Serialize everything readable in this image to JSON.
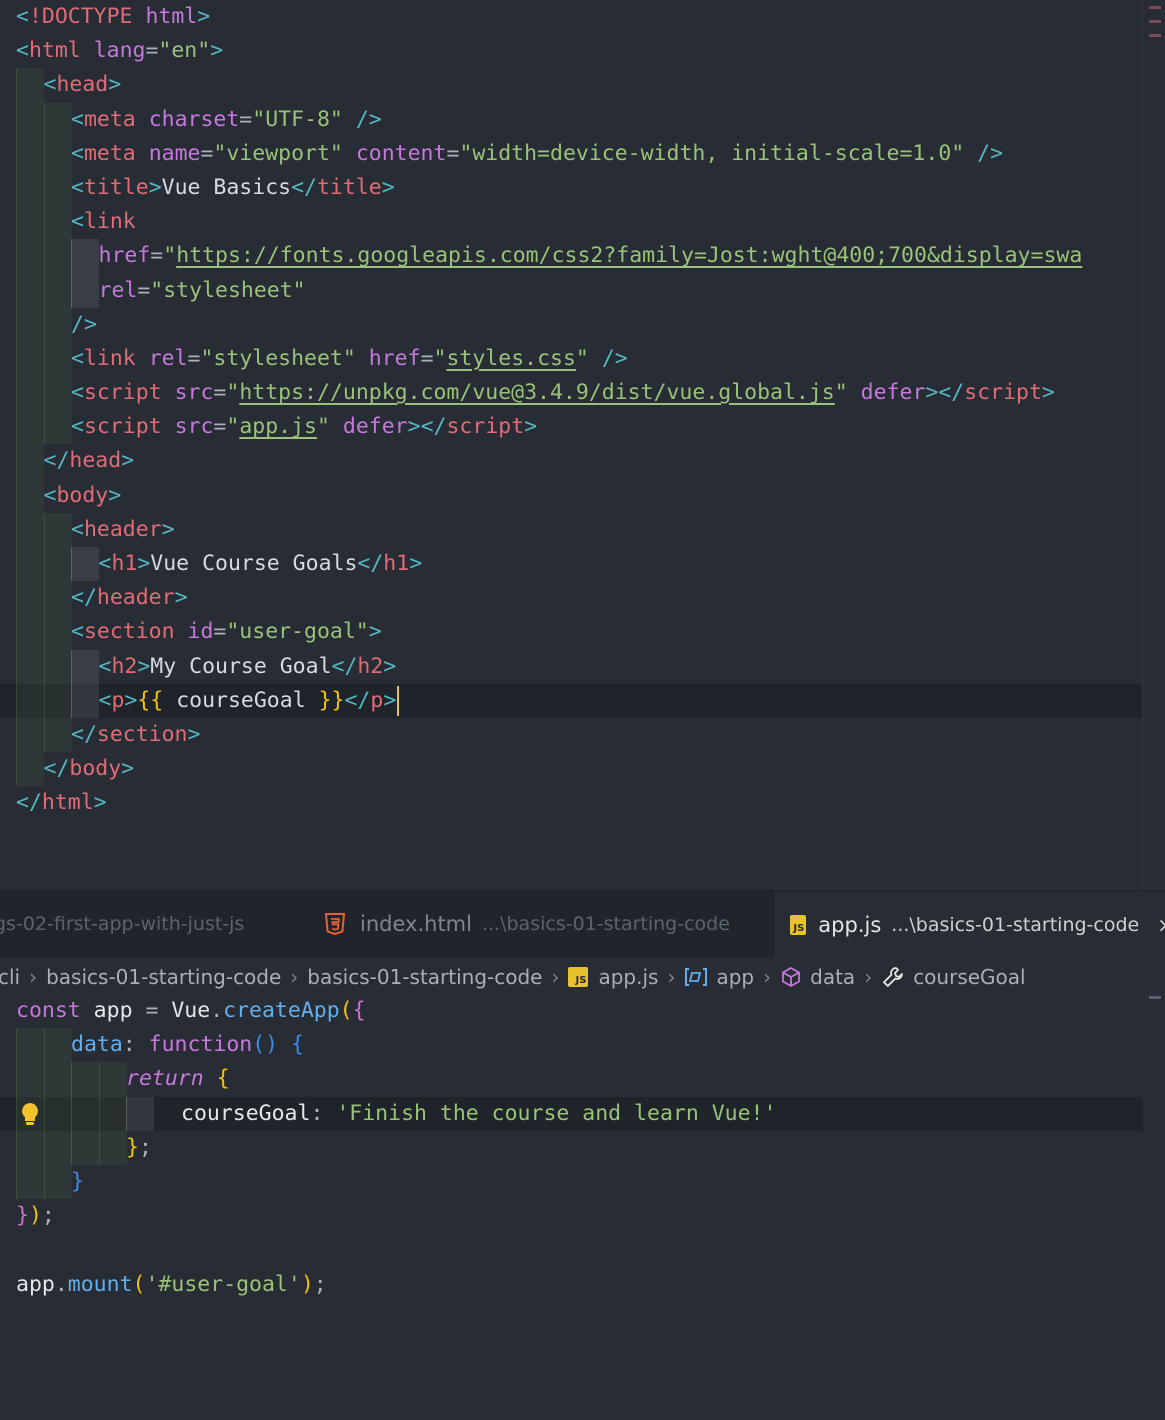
{
  "html_editor": {
    "lines": [
      [
        [
          "br",
          "<"
        ],
        [
          "tag",
          "!DOCTYPE"
        ],
        [
          "text",
          " "
        ],
        [
          "attr",
          "html"
        ],
        [
          "br",
          ">"
        ]
      ],
      [
        [
          "br",
          "<"
        ],
        [
          "tag",
          "html"
        ],
        [
          "text",
          " "
        ],
        [
          "attr",
          "lang"
        ],
        [
          "eq",
          "="
        ],
        [
          "str",
          "\"en\""
        ],
        [
          "br",
          ">"
        ]
      ],
      [
        [
          "br",
          "<"
        ],
        [
          "tag",
          "head"
        ],
        [
          "br",
          ">"
        ]
      ],
      [
        [
          "br",
          "<"
        ],
        [
          "tag",
          "meta"
        ],
        [
          "text",
          " "
        ],
        [
          "attr",
          "charset"
        ],
        [
          "eq",
          "="
        ],
        [
          "str",
          "\"UTF-8\""
        ],
        [
          "text",
          " "
        ],
        [
          "br",
          "/>"
        ]
      ],
      [
        [
          "br",
          "<"
        ],
        [
          "tag",
          "meta"
        ],
        [
          "text",
          " "
        ],
        [
          "attr",
          "name"
        ],
        [
          "eq",
          "="
        ],
        [
          "str",
          "\"viewport\""
        ],
        [
          "text",
          " "
        ],
        [
          "attr",
          "content"
        ],
        [
          "eq",
          "="
        ],
        [
          "str",
          "\"width=device-width, initial-scale=1.0\""
        ],
        [
          "text",
          " "
        ],
        [
          "br",
          "/>"
        ]
      ],
      [
        [
          "br",
          "<"
        ],
        [
          "tag",
          "title"
        ],
        [
          "br",
          ">"
        ],
        [
          "text",
          "Vue Basics"
        ],
        [
          "br",
          "</"
        ],
        [
          "tag",
          "title"
        ],
        [
          "br",
          ">"
        ]
      ],
      [
        [
          "br",
          "<"
        ],
        [
          "tag",
          "link"
        ]
      ],
      [
        [
          "attr",
          "href"
        ],
        [
          "eq",
          "="
        ],
        [
          "str",
          "\""
        ],
        [
          "url",
          "https://fonts.googleapis.com/css2?family=Jost:wght@400;700&display=swa"
        ]
      ],
      [
        [
          "attr",
          "rel"
        ],
        [
          "eq",
          "="
        ],
        [
          "str",
          "\"stylesheet\""
        ]
      ],
      [
        [
          "br",
          "/>"
        ]
      ],
      [
        [
          "br",
          "<"
        ],
        [
          "tag",
          "link"
        ],
        [
          "text",
          " "
        ],
        [
          "attr",
          "rel"
        ],
        [
          "eq",
          "="
        ],
        [
          "str",
          "\"stylesheet\""
        ],
        [
          "text",
          " "
        ],
        [
          "attr",
          "href"
        ],
        [
          "eq",
          "="
        ],
        [
          "str",
          "\""
        ],
        [
          "url",
          "styles.css"
        ],
        [
          "str",
          "\""
        ],
        [
          "text",
          " "
        ],
        [
          "br",
          "/>"
        ]
      ],
      [
        [
          "br",
          "<"
        ],
        [
          "tag",
          "script"
        ],
        [
          "text",
          " "
        ],
        [
          "attr",
          "src"
        ],
        [
          "eq",
          "="
        ],
        [
          "str",
          "\""
        ],
        [
          "url",
          "https://unpkg.com/vue@3.4.9/dist/vue.global.js"
        ],
        [
          "str",
          "\""
        ],
        [
          "text",
          " "
        ],
        [
          "attr",
          "defer"
        ],
        [
          "br",
          "></"
        ],
        [
          "tag",
          "script"
        ],
        [
          "br",
          ">"
        ]
      ],
      [
        [
          "br",
          "<"
        ],
        [
          "tag",
          "script"
        ],
        [
          "text",
          " "
        ],
        [
          "attr",
          "src"
        ],
        [
          "eq",
          "="
        ],
        [
          "str",
          "\""
        ],
        [
          "url",
          "app.js"
        ],
        [
          "str",
          "\""
        ],
        [
          "text",
          " "
        ],
        [
          "attr",
          "defer"
        ],
        [
          "br",
          "></"
        ],
        [
          "tag",
          "script"
        ],
        [
          "br",
          ">"
        ]
      ],
      [
        [
          "br",
          "</"
        ],
        [
          "tag",
          "head"
        ],
        [
          "br",
          ">"
        ]
      ],
      [
        [
          "br",
          "<"
        ],
        [
          "tag",
          "body"
        ],
        [
          "br",
          ">"
        ]
      ],
      [
        [
          "br",
          "<"
        ],
        [
          "tag",
          "header"
        ],
        [
          "br",
          ">"
        ]
      ],
      [
        [
          "br",
          "<"
        ],
        [
          "tag",
          "h1"
        ],
        [
          "br",
          ">"
        ],
        [
          "text",
          "Vue Course Goals"
        ],
        [
          "br",
          "</"
        ],
        [
          "tag",
          "h1"
        ],
        [
          "br",
          ">"
        ]
      ],
      [
        [
          "br",
          "</"
        ],
        [
          "tag",
          "header"
        ],
        [
          "br",
          ">"
        ]
      ],
      [
        [
          "br",
          "<"
        ],
        [
          "tag",
          "section"
        ],
        [
          "text",
          " "
        ],
        [
          "attr",
          "id"
        ],
        [
          "eq",
          "="
        ],
        [
          "str",
          "\"user-goal\""
        ],
        [
          "br",
          ">"
        ]
      ],
      [
        [
          "br",
          "<"
        ],
        [
          "tag",
          "h2"
        ],
        [
          "br",
          ">"
        ],
        [
          "text",
          "My Course Goal"
        ],
        [
          "br",
          "</"
        ],
        [
          "tag",
          "h2"
        ],
        [
          "br",
          ">"
        ]
      ],
      [
        [
          "br",
          "<"
        ],
        [
          "tag",
          "p"
        ],
        [
          "br",
          ">"
        ],
        [
          "b1",
          "{{"
        ],
        [
          "text",
          " courseGoal "
        ],
        [
          "b1",
          "}}"
        ],
        [
          "br",
          "</"
        ],
        [
          "tag",
          "p"
        ],
        [
          "br",
          ">"
        ]
      ],
      [
        [
          "br",
          "</"
        ],
        [
          "tag",
          "section"
        ],
        [
          "br",
          ">"
        ]
      ],
      [
        [
          "br",
          "</"
        ],
        [
          "tag",
          "body"
        ],
        [
          "br",
          ">"
        ]
      ],
      [
        [
          "br",
          "</"
        ],
        [
          "tag",
          "html"
        ],
        [
          "br",
          ">"
        ]
      ]
    ]
  },
  "tabs": {
    "first": "gs-02-first-app-with-just-js",
    "index_name": "index.html",
    "index_path": "...\\basics-01-starting-code",
    "app_name": "app.js",
    "app_path": "...\\basics-01-starting-code",
    "close": "×"
  },
  "breadcrumb": {
    "cli": "cli",
    "folder1": "basics-01-starting-code",
    "folder2": "basics-01-starting-code",
    "file": "app.js",
    "sym1": "app",
    "sym2": "data",
    "sym3": "courseGoal",
    "sep": "›"
  },
  "icons": {
    "html_icon": "html5-icon",
    "js_icon": "js-file-icon",
    "js_badge": "JS",
    "variable_icon": "variable-icon",
    "cube_icon": "cube-icon",
    "wrench_icon": "wrench-icon",
    "lightbulb_icon": "lightbulb-icon"
  },
  "js_editor": {
    "lines": [
      [
        [
          "kw",
          "const"
        ],
        [
          "var",
          " app "
        ],
        [
          "punc",
          "= "
        ],
        [
          "var",
          "Vue"
        ],
        [
          "punc",
          "."
        ],
        [
          "fn",
          "createApp"
        ],
        [
          "b1",
          "("
        ],
        [
          "b2",
          "{"
        ]
      ],
      [
        [
          "prop",
          "data"
        ],
        [
          "punc",
          ": "
        ],
        [
          "kw",
          "function"
        ],
        [
          "b3",
          "()"
        ],
        [
          "punc",
          " "
        ],
        [
          "b3",
          "{"
        ]
      ],
      [
        [
          "ret",
          "return"
        ],
        [
          "punc",
          " "
        ],
        [
          "b1",
          "{"
        ]
      ],
      [
        [
          "var",
          "courseGoal"
        ],
        [
          "punc",
          ": "
        ],
        [
          "jsstr",
          "'Finish the course and learn Vue!'"
        ]
      ],
      [
        [
          "b1",
          "}"
        ],
        [
          "punc",
          ";"
        ]
      ],
      [
        [
          "b3",
          "}"
        ]
      ],
      [
        [
          "b2",
          "}"
        ],
        [
          "b1",
          ")"
        ],
        [
          "punc",
          ";"
        ]
      ],
      [],
      [
        [
          "var",
          "app"
        ],
        [
          "punc",
          "."
        ],
        [
          "fn",
          "mount"
        ],
        [
          "b1",
          "("
        ],
        [
          "jsstr",
          "'#user-goal'"
        ],
        [
          "b1",
          ")"
        ],
        [
          "punc",
          ";"
        ]
      ]
    ]
  },
  "colors": {
    "background": "#282c34",
    "tabbar": "#21252b",
    "cursor": "#f0c041"
  }
}
